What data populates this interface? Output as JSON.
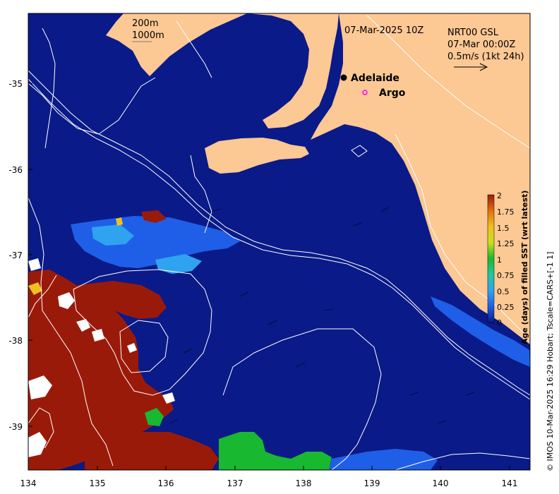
{
  "map": {
    "date_label": "07-Mar-2025 10Z",
    "current_product": "NRT00 GSL",
    "current_time": "07-Mar 00:00Z",
    "vector_scale": "0.5m/s (1kt 24h)",
    "isobaths": [
      "200m",
      "1000m"
    ],
    "place_labels": [
      {
        "name": "Adelaide",
        "marker": "filled-circle",
        "color": "#000000"
      },
      {
        "name": "Argo",
        "marker": "open-circle",
        "color": "#ff00ff"
      }
    ],
    "lon_ticks": [
      "134",
      "135",
      "136",
      "137",
      "138",
      "139",
      "140",
      "141"
    ],
    "lat_ticks": [
      "-35",
      "-36",
      "-37",
      "-38",
      "-39"
    ],
    "credit": "© IMOS 10-Mar-2025 16:29 Hobart; Tscale=CARS+[-1 1]",
    "colors": {
      "ocean": "#0a1a88",
      "land": "#fcc894",
      "bathymetry": "#ffffff",
      "argo": "#ff00ff"
    }
  },
  "colorbar": {
    "title": "Age (days) of filled SST (wrt latest)",
    "range": [
      0,
      2
    ],
    "tick_labels": [
      "2",
      "1.75",
      "1.5",
      "1.25",
      "1",
      "0.75",
      "0.5",
      "0.25",
      "0"
    ],
    "color_stops": [
      "#0a1a88",
      "#1f5fe8",
      "#2fa3f0",
      "#20c8a0",
      "#18b830",
      "#c8e020",
      "#f0c020",
      "#e07010",
      "#9a1a0a"
    ]
  }
}
